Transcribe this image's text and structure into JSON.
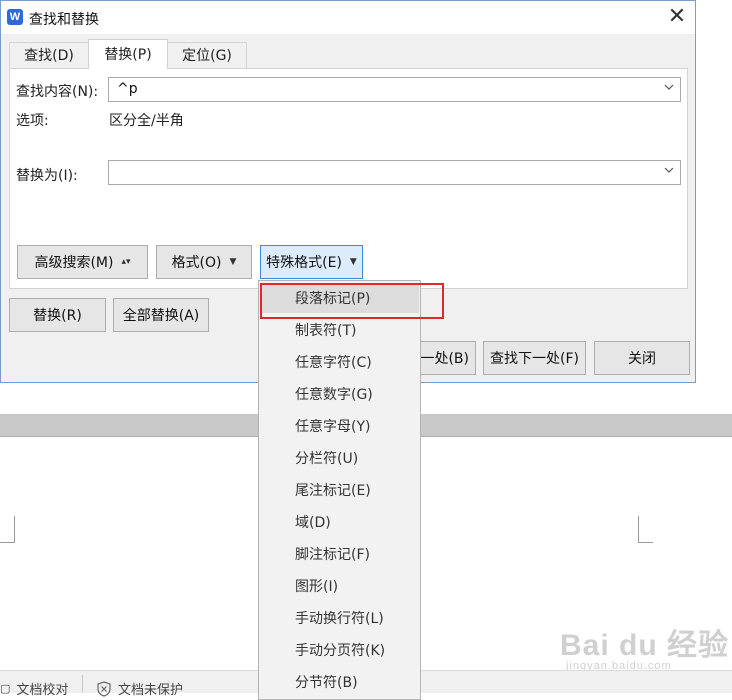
{
  "dialog": {
    "title": "查找和替换",
    "close": "✕",
    "app_icon": "W",
    "tabs": [
      {
        "label": "查找(D)",
        "active": false
      },
      {
        "label": "替换(P)",
        "active": true
      },
      {
        "label": "定位(G)",
        "active": false
      }
    ],
    "find_label": "查找内容(N):",
    "find_value": "^p",
    "options_label": "选项:",
    "options_value": "区分全/半角",
    "replace_label": "替换为(I):",
    "replace_value": "",
    "buttons": {
      "advanced": "高级搜索(M)",
      "format": "格式(O)",
      "special": "特殊格式(E)",
      "replace": "替换(R)",
      "replace_all": "全部替换(A)",
      "find_prev_partial": "一处(B)",
      "find_next": "查找下一处(F)",
      "close": "关闭"
    }
  },
  "special_menu": {
    "items": [
      "段落标记(P)",
      "制表符(T)",
      "任意字符(C)",
      "任意数字(G)",
      "任意字母(Y)",
      "分栏符(U)",
      "尾注标记(E)",
      "域(D)",
      "脚注标记(F)",
      "图形(I)",
      "手动换行符(L)",
      "手动分页符(K)",
      "分节符(B)"
    ],
    "highlighted_index": 0
  },
  "statusbar": {
    "proofread": "文档校对",
    "protect": "文档未保护"
  },
  "watermark": {
    "main": "Bai du 经验",
    "sub": "jingyan.baidu.com"
  },
  "colors": {
    "accent": "#3c8ad8",
    "highlight_box": "#e3282c",
    "app_icon": "#2b6ad8"
  }
}
